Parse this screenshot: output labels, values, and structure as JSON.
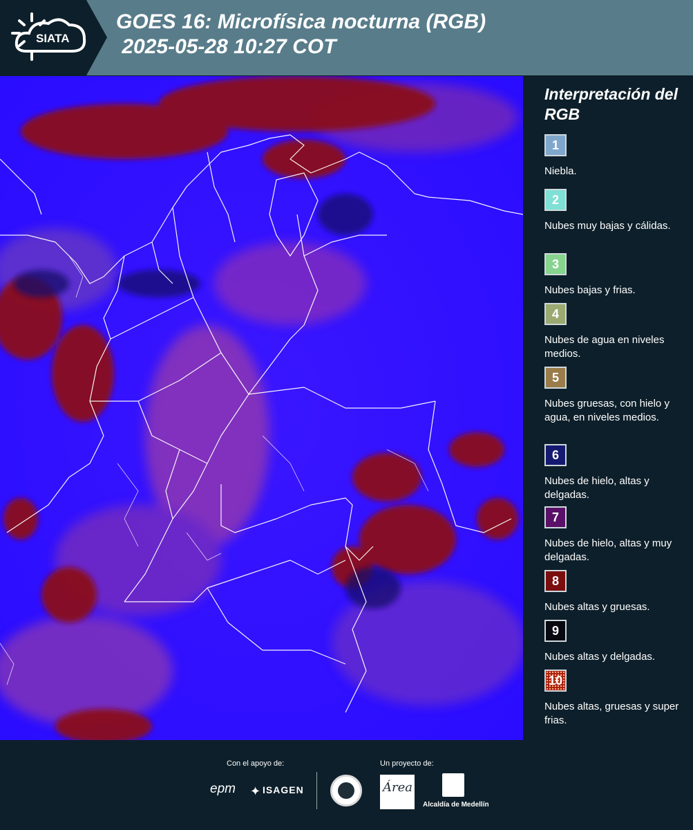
{
  "header": {
    "logo_text": "SIATA",
    "title": "GOES 16: Microfísica nocturna (RGB)\n 2025-05-28 10:27 COT",
    "bg_color": "#587c8a"
  },
  "legend": {
    "title": "Interpretación del RGB",
    "items": [
      {
        "number": "1",
        "label": "Niebla.",
        "color": "#7fa7cc"
      },
      {
        "number": "2",
        "label": "Nubes muy bajas y cálidas.",
        "color": "#7fe0d6"
      },
      {
        "number": "3",
        "label": "Nubes bajas y frias.",
        "color": "#86d48e"
      },
      {
        "number": "4",
        "label": "Nubes de agua en niveles medios.",
        "color": "#9aaa70"
      },
      {
        "number": "5",
        "label": "Nubes gruesas, con hielo y agua, en niveles medios.",
        "color": "#9a7c4a"
      },
      {
        "number": "6",
        "label": "Nubes de hielo, altas y delgadas.",
        "color": "#151a70"
      },
      {
        "number": "7",
        "label": "Nubes de hielo, altas y muy delgadas.",
        "color": "#5a1068"
      },
      {
        "number": "8",
        "label": "Nubes altas y gruesas.",
        "color": "#7a0e0e"
      },
      {
        "number": "9",
        "label": "Nubes altas y delgadas.",
        "color": "#080810"
      },
      {
        "number": "10",
        "label": "Nubes altas, gruesas y super frias.",
        "color": "#a82010"
      }
    ]
  },
  "footer": {
    "support_label": "Con el apoyo de:",
    "project_label": "Un proyecto de:",
    "sponsor_1": "epm",
    "sponsor_2": "ISAGEN",
    "area_logo_text": "Área",
    "alcaldia_text": "Alcaldía de Medellín"
  }
}
